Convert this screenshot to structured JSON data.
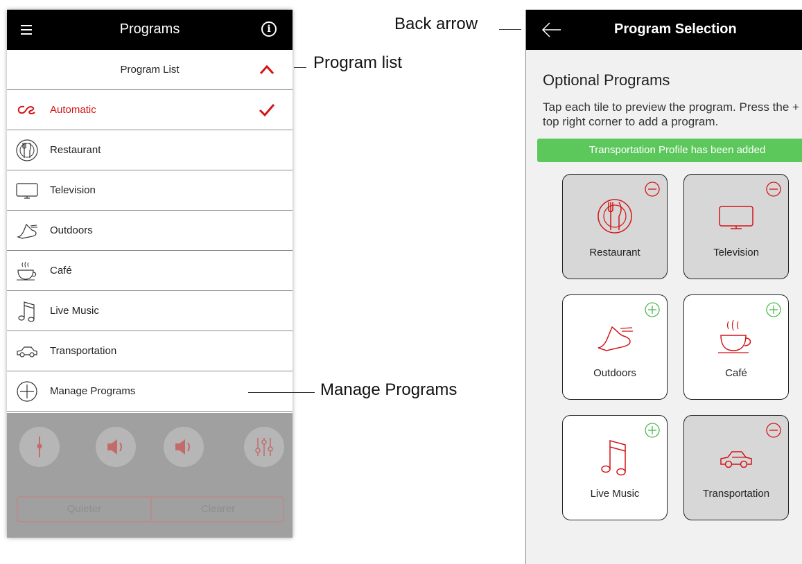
{
  "left_screen": {
    "title": "Programs",
    "list_header": "Program List",
    "items": [
      {
        "label": "Automatic",
        "icon": "automatic-logo-icon",
        "active": true
      },
      {
        "label": "Restaurant",
        "icon": "fork-knife-plate-icon"
      },
      {
        "label": "Television",
        "icon": "television-icon"
      },
      {
        "label": "Outdoors",
        "icon": "running-shoe-icon"
      },
      {
        "label": "Café",
        "icon": "coffee-cup-icon"
      },
      {
        "label": "Live Music",
        "icon": "music-note-icon"
      },
      {
        "label": "Transportation",
        "icon": "car-icon"
      },
      {
        "label": "Manage Programs",
        "icon": "plus-circle-icon"
      }
    ],
    "segmented": {
      "left": "Quieter",
      "right": "Clearer"
    }
  },
  "annotations": {
    "back_arrow": "Back arrow",
    "program_list": "Program list",
    "manage_programs": "Manage Programs"
  },
  "right_screen": {
    "title": "Program Selection",
    "heading": "Optional Programs",
    "description": "Tap each tile to preview the program. Press the + in the top right corner to add a program.",
    "banner": "Transportation Profile has been added",
    "tiles": [
      {
        "label": "Restaurant",
        "state": "added"
      },
      {
        "label": "Television",
        "state": "added"
      },
      {
        "label": "Outdoors",
        "state": "available"
      },
      {
        "label": "Café",
        "state": "available"
      },
      {
        "label": "Live Music",
        "state": "available"
      },
      {
        "label": "Transportation",
        "state": "added"
      }
    ]
  },
  "colors": {
    "accent_red": "#d41316",
    "add_green": "#4cb84c",
    "banner_green": "#5cc85c",
    "topbar": "#000000"
  }
}
